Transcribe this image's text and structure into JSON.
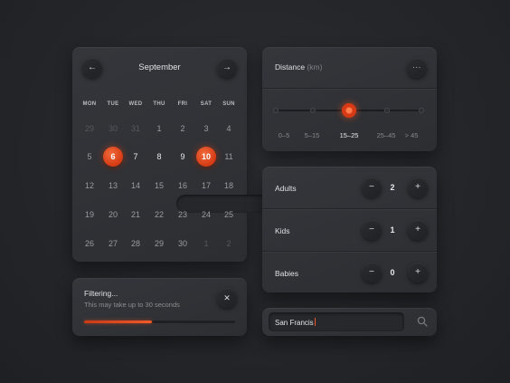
{
  "calendar": {
    "month": "September",
    "weekdays": [
      "MON",
      "TUE",
      "WED",
      "THU",
      "FRI",
      "SAT",
      "SUN"
    ],
    "weeks": [
      [
        "29",
        "30",
        "31",
        "1",
        "2",
        "3",
        "4"
      ],
      [
        "5",
        "6",
        "7",
        "8",
        "9",
        "10",
        "11"
      ],
      [
        "12",
        "13",
        "14",
        "15",
        "16",
        "17",
        "18"
      ],
      [
        "19",
        "20",
        "21",
        "22",
        "23",
        "24",
        "25"
      ],
      [
        "26",
        "27",
        "28",
        "29",
        "30",
        "1",
        "2"
      ]
    ],
    "range_start": "6",
    "range_end": "10",
    "prev_icon": "arrow-left-icon",
    "next_icon": "arrow-right-icon"
  },
  "filter": {
    "title": "Filtering...",
    "subtitle": "This may take up to 30 seconds",
    "progress": 0.45,
    "close_icon": "close-icon"
  },
  "distance": {
    "title": "Distance",
    "unit": "(km)",
    "options": [
      "0–5",
      "5–15",
      "15–25",
      "25–45",
      "> 45"
    ],
    "selected_index": 2,
    "more_icon": "more-icon"
  },
  "guests": [
    {
      "label": "Adults",
      "value": "2"
    },
    {
      "label": "Kids",
      "value": "1"
    },
    {
      "label": "Babies",
      "value": "0"
    }
  ],
  "search": {
    "value": "San Francis",
    "icon": "search-icon"
  },
  "colors": {
    "accent": "#e8461c",
    "background": "#25272a",
    "card": "#303236"
  }
}
